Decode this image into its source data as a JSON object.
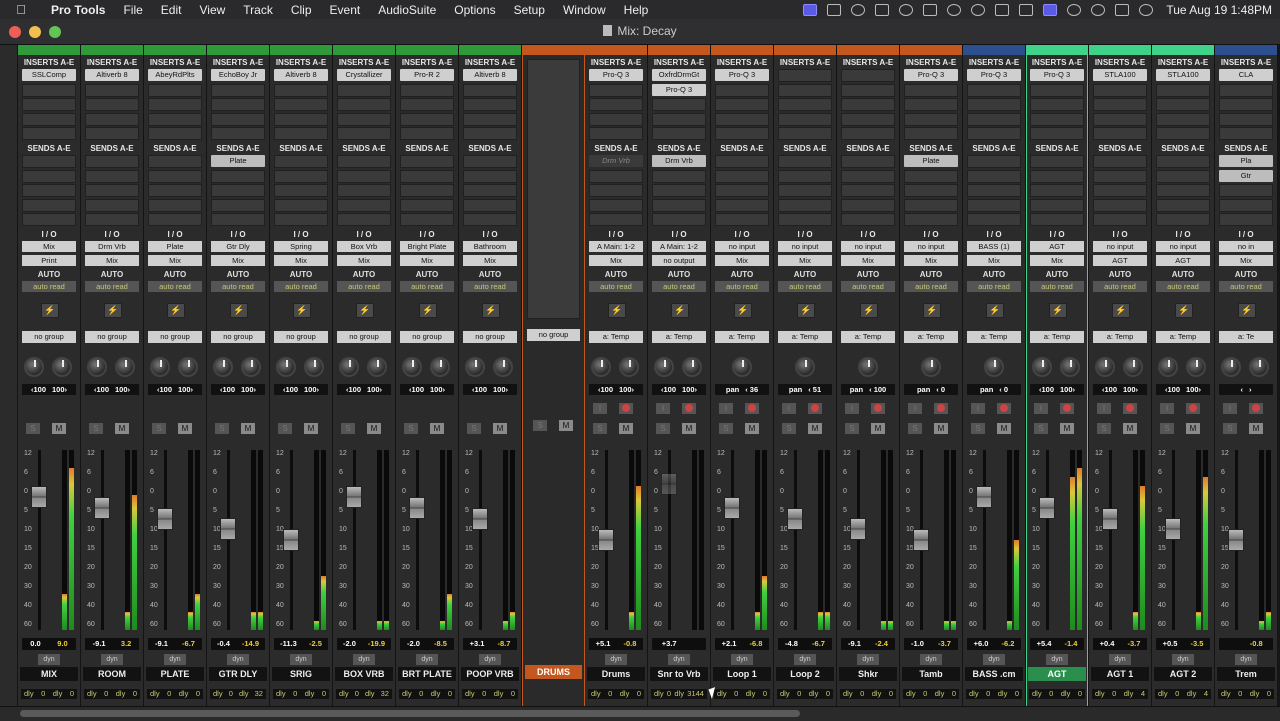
{
  "menubar": {
    "app": "Pro Tools",
    "items": [
      "File",
      "Edit",
      "View",
      "Track",
      "Clip",
      "Event",
      "AudioSuite",
      "Options",
      "Setup",
      "Window",
      "Help"
    ],
    "clock": "Tue Aug 19  1:48PM"
  },
  "window": {
    "title": "Mix: Decay"
  },
  "labels": {
    "inserts": "INSERTS A-E",
    "sends": "SENDS A-E",
    "io": "I / O",
    "auto": "AUTO",
    "dly": "dly",
    "dyn": "dyn"
  },
  "strips": [
    {
      "name": "MIX",
      "color": "#2f9a3a",
      "inserts": [
        "SSLComp"
      ],
      "sends": [],
      "input": "Mix",
      "output": "Print",
      "auto": "auto read",
      "group": "no group",
      "pan": [
        "100",
        "100"
      ],
      "vol": [
        "0.0",
        "9.0"
      ],
      "dly": [
        "0",
        "0"
      ],
      "meter": [
        0.2,
        0.9
      ]
    },
    {
      "name": "ROOM",
      "color": "#2f9a3a",
      "inserts": [
        "Altiverb 8"
      ],
      "sends": [],
      "input": "Drm Vrb",
      "output": "Mix",
      "auto": "auto read",
      "group": "no group",
      "pan": [
        "100",
        "100"
      ],
      "vol": [
        "-9.1",
        "3.2"
      ],
      "dly": [
        "0",
        "0"
      ],
      "meter": [
        0.1,
        0.75
      ]
    },
    {
      "name": "PLATE",
      "color": "#2f9a3a",
      "inserts": [
        "AbeyRdPlts"
      ],
      "sends": [],
      "input": "Plate",
      "output": "Mix",
      "auto": "auto read",
      "group": "no group",
      "pan": [
        "100",
        "100"
      ],
      "vol": [
        "-9.1",
        "-6.7"
      ],
      "dly": [
        "0",
        "0"
      ],
      "meter": [
        0.1,
        0.2
      ]
    },
    {
      "name": "GTR DLY",
      "color": "#2f9a3a",
      "inserts": [
        "EchoBoy Jr"
      ],
      "sends": [
        "Plate"
      ],
      "input": "Gtr Dly",
      "output": "Mix",
      "auto": "auto read",
      "group": "no group",
      "pan": [
        "100",
        "100"
      ],
      "vol": [
        "-0.4",
        "-14.9"
      ],
      "dly": [
        "0",
        "32"
      ],
      "meter": [
        0.1,
        0.1
      ]
    },
    {
      "name": "SRIG",
      "color": "#2f9a3a",
      "inserts": [
        "Altiverb 8"
      ],
      "sends": [],
      "input": "Spring",
      "output": "Mix",
      "auto": "auto read",
      "group": "no group",
      "pan": [
        "100",
        "100"
      ],
      "vol": [
        "-11.3",
        "-2.5"
      ],
      "dly": [
        "0",
        "0"
      ],
      "meter": [
        0.05,
        0.3
      ]
    },
    {
      "name": "BOX VRB",
      "color": "#2f9a3a",
      "inserts": [
        "Crystallizer"
      ],
      "sends": [],
      "input": "Box Vrb",
      "output": "Mix",
      "auto": "auto read",
      "group": "no group",
      "pan": [
        "100",
        "100"
      ],
      "vol": [
        "-2.0",
        "-19.9"
      ],
      "dly": [
        "0",
        "32"
      ],
      "meter": [
        0.05,
        0.05
      ]
    },
    {
      "name": "BRT PLATE",
      "color": "#2f9a3a",
      "inserts": [
        "Pro-R 2"
      ],
      "sends": [],
      "input": "Bright Plate",
      "output": "Mix",
      "auto": "auto read",
      "group": "no group",
      "pan": [
        "100",
        "100"
      ],
      "vol": [
        "-2.0",
        "-8.5"
      ],
      "dly": [
        "0",
        "0"
      ],
      "meter": [
        0.05,
        0.2
      ]
    },
    {
      "name": "POOP VRB",
      "color": "#2f9a3a",
      "inserts": [
        "Altiverb 8"
      ],
      "sends": [],
      "input": "Bathroom",
      "output": "Mix",
      "auto": "auto read",
      "group": "no group",
      "pan": [
        "100",
        "100"
      ],
      "vol": [
        "+3.1",
        "-8.7"
      ],
      "dly": [
        "0",
        "0"
      ],
      "meter": [
        0.05,
        0.1
      ]
    },
    {
      "name": "DRUMS",
      "color": "#c4571d",
      "folder": true,
      "group": "no group"
    },
    {
      "name": "Drums",
      "color": "#c4571d",
      "inserts": [
        "Pro-Q 3"
      ],
      "sends": [
        "Drm Vrb"
      ],
      "sendGhost": true,
      "input": "A Main: 1-2",
      "output": "Mix",
      "auto": "auto read",
      "group": "a: Temp",
      "pan": [
        "100",
        "100"
      ],
      "vol": [
        "+5.1",
        "-0.8"
      ],
      "dly": [
        "0",
        "0"
      ],
      "meter": [
        0.1,
        0.8
      ]
    },
    {
      "name": "Snr to Vrb",
      "color": "#c4571d",
      "inserts": [
        "OxfrdDrmGt",
        "Pro-Q 3"
      ],
      "sends": [
        "Drm Vrb"
      ],
      "input": "A Main: 1-2",
      "output": "no output",
      "auto": "auto read",
      "group": "a: Temp",
      "pan": [
        "100",
        "100"
      ],
      "vol": [
        "+3.7",
        ""
      ],
      "dly": [
        "0",
        "3144"
      ],
      "meter": [
        0.0,
        0.0
      ],
      "inactive": true
    },
    {
      "name": "Loop 1",
      "color": "#c4571d",
      "inserts": [
        "Pro-Q 3"
      ],
      "sends": [],
      "input": "no input",
      "output": "Mix",
      "auto": "auto read",
      "group": "a: Temp",
      "pan": [
        "pan",
        "36"
      ],
      "vol": [
        "+2.1",
        "-6.8"
      ],
      "dly": [
        "0",
        "0"
      ],
      "meter": [
        0.1,
        0.3
      ]
    },
    {
      "name": "Loop 2",
      "color": "#c4571d",
      "inserts": [],
      "sends": [],
      "input": "no input",
      "output": "Mix",
      "auto": "auto read",
      "group": "a: Temp",
      "pan": [
        "pan",
        "51"
      ],
      "vol": [
        "-4.8",
        "-6.7"
      ],
      "dly": [
        "0",
        "0"
      ],
      "meter": [
        0.1,
        0.1
      ]
    },
    {
      "name": "Shkr",
      "color": "#c4571d",
      "inserts": [],
      "sends": [],
      "input": "no input",
      "output": "Mix",
      "auto": "auto read",
      "group": "a: Temp",
      "pan": [
        "pan",
        "100"
      ],
      "vol": [
        "-9.1",
        "-2.4"
      ],
      "dly": [
        "0",
        "0"
      ],
      "meter": [
        0.05,
        0.05
      ]
    },
    {
      "name": "Tamb",
      "color": "#c4571d",
      "inserts": [
        "Pro-Q 3"
      ],
      "sends": [
        "Plate"
      ],
      "input": "no input",
      "output": "Mix",
      "auto": "auto read",
      "group": "a: Temp",
      "pan": [
        "pan",
        "0"
      ],
      "vol": [
        "-1.0",
        "-3.7"
      ],
      "dly": [
        "0",
        "0"
      ],
      "meter": [
        0.05,
        0.05
      ]
    },
    {
      "name": "BASS .cm",
      "color": "#2b4f8f",
      "inserts": [
        "Pro-Q 3"
      ],
      "sends": [],
      "input": "BASS (1)",
      "output": "Mix",
      "auto": "auto read",
      "group": "a: Temp",
      "pan": [
        "pan",
        "0"
      ],
      "vol": [
        "+6.0",
        "-6.2"
      ],
      "dly": [
        "0",
        "0"
      ],
      "meter": [
        0.05,
        0.5
      ]
    },
    {
      "name": "AGT",
      "color": "#3fd38a",
      "inserts": [
        "Pro-Q 3"
      ],
      "sends": [],
      "input": "AGT",
      "output": "Mix",
      "auto": "auto read",
      "group": "a: Temp",
      "pan": [
        "100",
        "100"
      ],
      "vol": [
        "+5.4",
        "-1.4"
      ],
      "dly": [
        "0",
        "0"
      ],
      "meter": [
        0.85,
        0.9
      ],
      "selected": true
    },
    {
      "name": "AGT 1",
      "color": "#3fd38a",
      "inserts": [
        "STLA100"
      ],
      "sends": [],
      "input": "no input",
      "output": "AGT",
      "auto": "auto read",
      "group": "a: Temp",
      "pan": [
        "100",
        "100"
      ],
      "vol": [
        "+0.4",
        "-3.7"
      ],
      "dly": [
        "0",
        "4"
      ],
      "meter": [
        0.1,
        0.8
      ]
    },
    {
      "name": "AGT 2",
      "color": "#3fd38a",
      "inserts": [
        "STLA100"
      ],
      "sends": [],
      "input": "no input",
      "output": "AGT",
      "auto": "auto read",
      "group": "a: Temp",
      "pan": [
        "100",
        "100"
      ],
      "vol": [
        "+0.5",
        "-3.5"
      ],
      "dly": [
        "0",
        "4"
      ],
      "meter": [
        0.1,
        0.85
      ]
    },
    {
      "name": "Trem",
      "color": "#2b4f8f",
      "inserts": [
        "CLA"
      ],
      "sends": [
        "Pla",
        "Gtr"
      ],
      "input": "no in",
      "output": "Mix",
      "auto": "auto read",
      "group": "a: Te",
      "pan": [
        "",
        ""
      ],
      "vol": [
        "",
        "-0.8"
      ],
      "dly": [
        "0",
        "0"
      ],
      "meter": [
        0.05,
        0.1
      ]
    }
  ]
}
